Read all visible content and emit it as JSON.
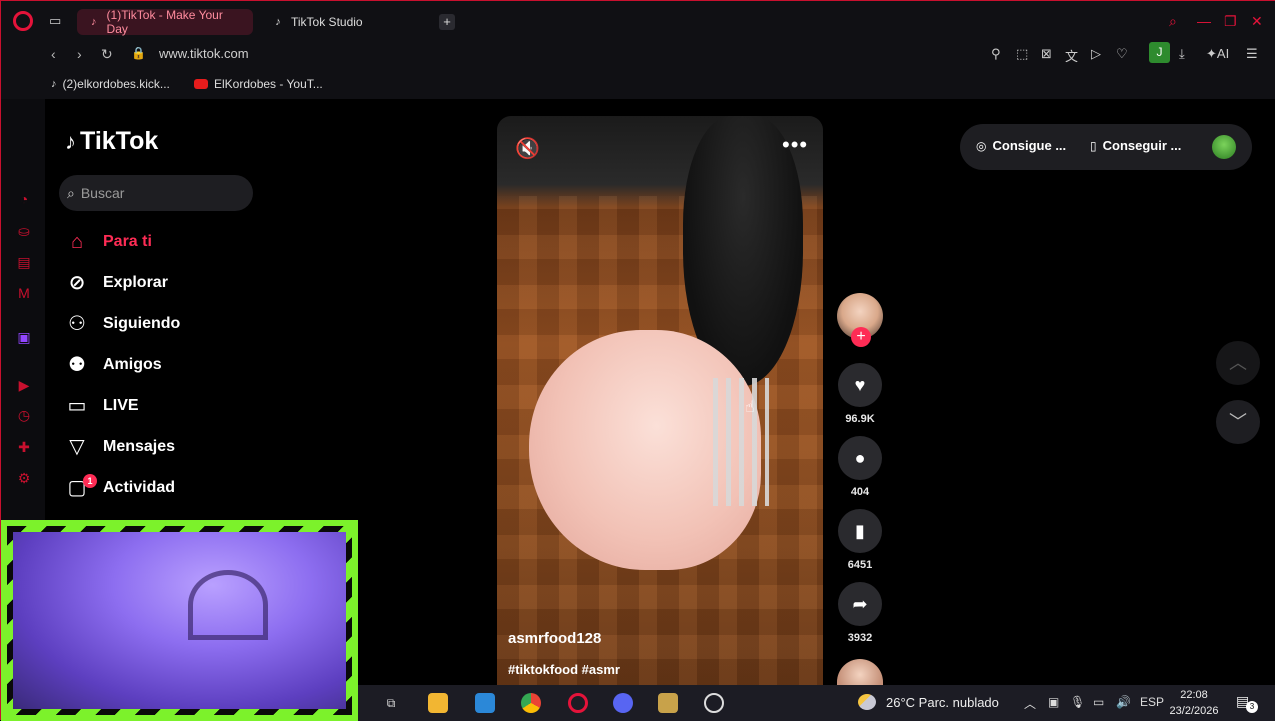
{
  "browser": {
    "tabs": [
      {
        "label": "(1)TikTok - Make Your Day",
        "active": true
      },
      {
        "label": "TikTok Studio",
        "active": false
      }
    ],
    "new_tab": "+",
    "url": "www.tiktok.com",
    "ai_label": "AI",
    "profile_initial": "J",
    "bookmarks": [
      {
        "label": "(2)elkordobes.kick..."
      },
      {
        "label": "ElKordobes - YouT..."
      }
    ]
  },
  "tiktok": {
    "logo": "TikTok",
    "search_placeholder": "Buscar",
    "menu": [
      {
        "label": "Para ti",
        "icon": "home-icon",
        "active": true
      },
      {
        "label": "Explorar",
        "icon": "compass-icon"
      },
      {
        "label": "Siguiendo",
        "icon": "following-icon"
      },
      {
        "label": "Amigos",
        "icon": "friends-icon"
      },
      {
        "label": "LIVE",
        "icon": "live-icon"
      },
      {
        "label": "Mensajes",
        "icon": "messages-icon"
      },
      {
        "label": "Actividad",
        "icon": "activity-icon",
        "badge": "1"
      }
    ],
    "top_buttons": {
      "coins": "Consigue ...",
      "app": "Conseguir ..."
    },
    "video": {
      "username": "asmrfood128",
      "hashtags": "#tiktokfood #asmr",
      "likes": "96.9K",
      "comments": "404",
      "saves": "6451",
      "shares": "3932"
    }
  },
  "taskbar": {
    "temperature": "26°C",
    "weather": "Parc. nublado",
    "language": "ESP",
    "time": "22:08",
    "date": "23/2/2026",
    "notifications": "3"
  },
  "colors": {
    "accent": "#fe2c55",
    "opera_red": "#e5133a",
    "webcam_border": "#7cf22b"
  }
}
